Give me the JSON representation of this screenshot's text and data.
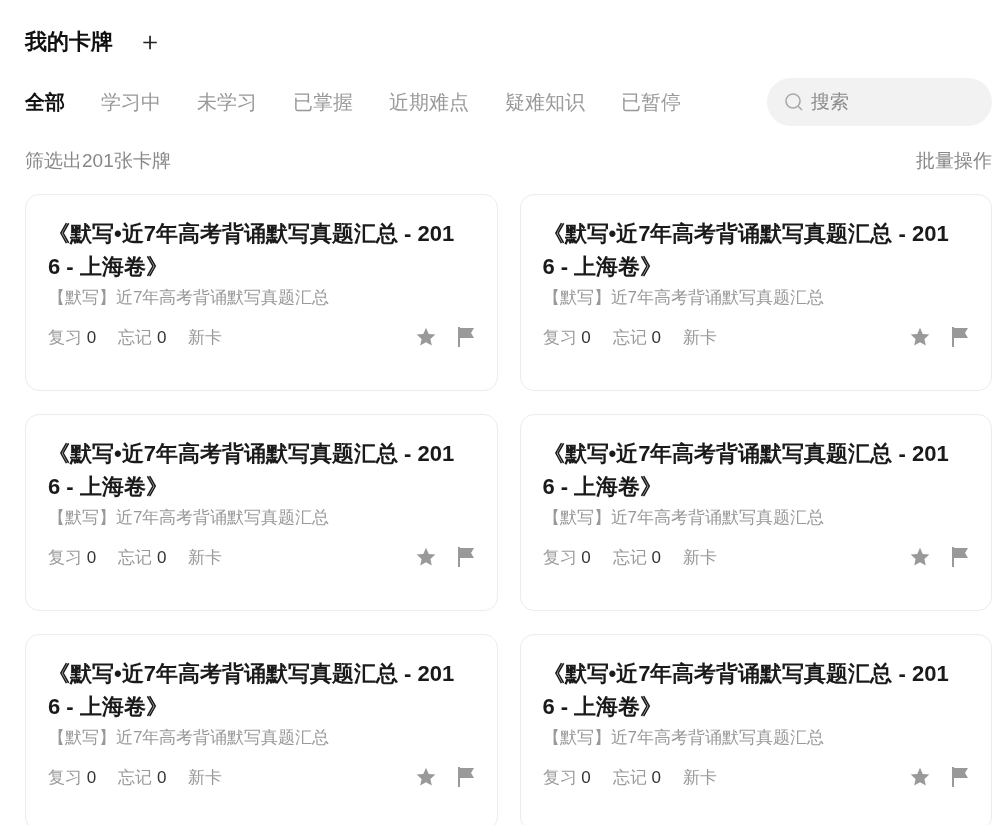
{
  "header": {
    "title": "我的卡牌",
    "add_icon_text": "＋"
  },
  "tabs": [
    {
      "label": "全部",
      "selected": true
    },
    {
      "label": "学习中",
      "selected": false
    },
    {
      "label": "未学习",
      "selected": false
    },
    {
      "label": "已掌握",
      "selected": false
    },
    {
      "label": "近期难点",
      "selected": false
    },
    {
      "label": "疑难知识",
      "selected": false
    },
    {
      "label": "已暂停",
      "selected": false
    }
  ],
  "search": {
    "placeholder": "搜索"
  },
  "summary": {
    "count_text": "筛选出201张卡牌",
    "batch_action": "批量操作"
  },
  "cards": [
    {
      "title": "《默写•近7年高考背诵默写真题汇总 - 2016 - 上海卷》",
      "deck": "【默写】近7年高考背诵默写真题汇总",
      "review_label": "复习",
      "review_count": "0",
      "forget_label": "忘记",
      "forget_count": "0",
      "status": "新卡"
    },
    {
      "title": "《默写•近7年高考背诵默写真题汇总 - 2016 - 上海卷》",
      "deck": "【默写】近7年高考背诵默写真题汇总",
      "review_label": "复习",
      "review_count": "0",
      "forget_label": "忘记",
      "forget_count": "0",
      "status": "新卡"
    },
    {
      "title": "《默写•近7年高考背诵默写真题汇总 - 2016 - 上海卷》",
      "deck": "【默写】近7年高考背诵默写真题汇总",
      "review_label": "复习",
      "review_count": "0",
      "forget_label": "忘记",
      "forget_count": "0",
      "status": "新卡"
    },
    {
      "title": "《默写•近7年高考背诵默写真题汇总 - 2016 - 上海卷》",
      "deck": "【默写】近7年高考背诵默写真题汇总",
      "review_label": "复习",
      "review_count": "0",
      "forget_label": "忘记",
      "forget_count": "0",
      "status": "新卡"
    },
    {
      "title": "《默写•近7年高考背诵默写真题汇总 - 2016 - 上海卷》",
      "deck": "【默写】近7年高考背诵默写真题汇总",
      "review_label": "复习",
      "review_count": "0",
      "forget_label": "忘记",
      "forget_count": "0",
      "status": "新卡"
    },
    {
      "title": "《默写•近7年高考背诵默写真题汇总 - 2016 - 上海卷》",
      "deck": "【默写】近7年高考背诵默写真题汇总",
      "review_label": "复习",
      "review_count": "0",
      "forget_label": "忘记",
      "forget_count": "0",
      "status": "新卡"
    }
  ]
}
